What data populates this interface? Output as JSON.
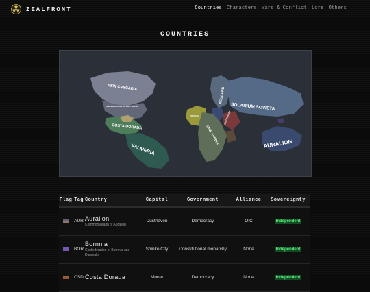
{
  "brand": {
    "name": "ZEALFRONT"
  },
  "nav": [
    "Countries",
    "Characters",
    "Wars & Conflict",
    "Lore",
    "Others"
  ],
  "page_title": "COUNTRIES",
  "map_labels": {
    "new_cascadia": "NEW CASCADIA",
    "usa_like": "UNITED STATES OF BELTHAZAR",
    "costa_dorada": "COSTA DORADA",
    "valmeria": "VALMERIA",
    "reugard": "REUGARD",
    "solarium": "SOLARIUM SOVIETA",
    "auralion": "AURALION",
    "new_afrika": "NEW AFRIKA",
    "small1": "EAST TRELAN",
    "small2": "ZOPAVIA"
  },
  "table": {
    "headers": [
      "Flag",
      "Tag",
      "Country",
      "Capital",
      "Government",
      "Alliance",
      "Sovereignty"
    ],
    "rows": [
      {
        "tag": "AUR",
        "country": "Auralion",
        "full": "Commonwealth of Auralion",
        "capital": "Dusthaven",
        "government": "Democracy",
        "alliance": "OIC",
        "sovereignty": "Independent",
        "flag_color": "#6b5a7a"
      },
      {
        "tag": "BOR",
        "country": "Bornnia",
        "full": "Confederation of Bornnia and Danmalls",
        "capital": "Shinkō City",
        "government": "Constitutional monarchy",
        "alliance": "None",
        "sovereignty": "Independent",
        "flag_color": "#7a55b8"
      },
      {
        "tag": "CSD",
        "country": "Costa Dorada",
        "full": "",
        "capital": "Monte",
        "government": "Democracy",
        "alliance": "None",
        "sovereignty": "Independent",
        "flag_color": "#8a6a3a"
      }
    ]
  }
}
